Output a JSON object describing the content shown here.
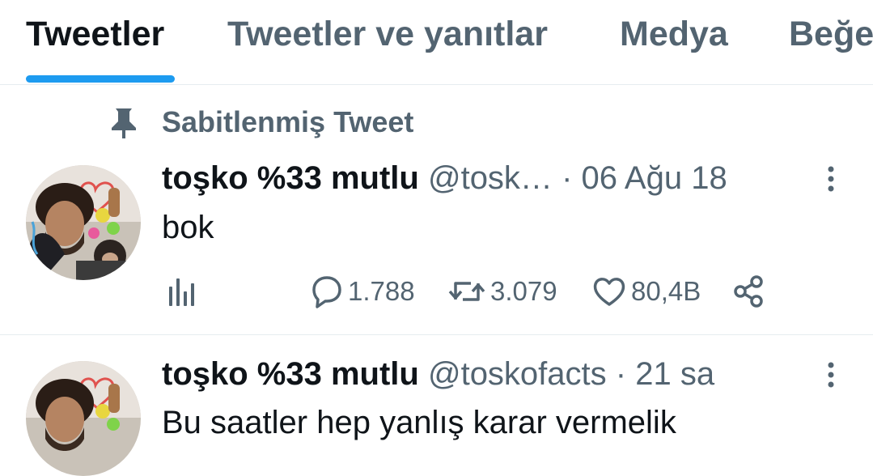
{
  "tabs": [
    {
      "label": "Tweetler",
      "active": true
    },
    {
      "label": "Tweetler ve yanıtlar",
      "active": false
    },
    {
      "label": "Medya",
      "active": false
    },
    {
      "label": "Beğe",
      "active": false
    }
  ],
  "accent_color": "#1d9bf0",
  "pinned": {
    "label": "Sabitlenmiş Tweet",
    "icon": "pin-icon"
  },
  "tweets": [
    {
      "display_name": "toşko %33 mutlu",
      "handle": "@tosk…",
      "separator": "·",
      "time": "06 Ağu 18",
      "text": "bok",
      "stats": {
        "replies": "1.788",
        "retweets": "3.079",
        "likes": "80,4B"
      }
    },
    {
      "display_name": "toşko %33 mutlu",
      "handle": "@toskofacts",
      "separator": "·",
      "time": "21 sa",
      "text": "Bu saatler hep yanlış karar vermelik"
    }
  ],
  "icons": [
    "analytics-icon",
    "reply-icon",
    "retweet-icon",
    "like-icon",
    "share-icon",
    "more-icon"
  ]
}
